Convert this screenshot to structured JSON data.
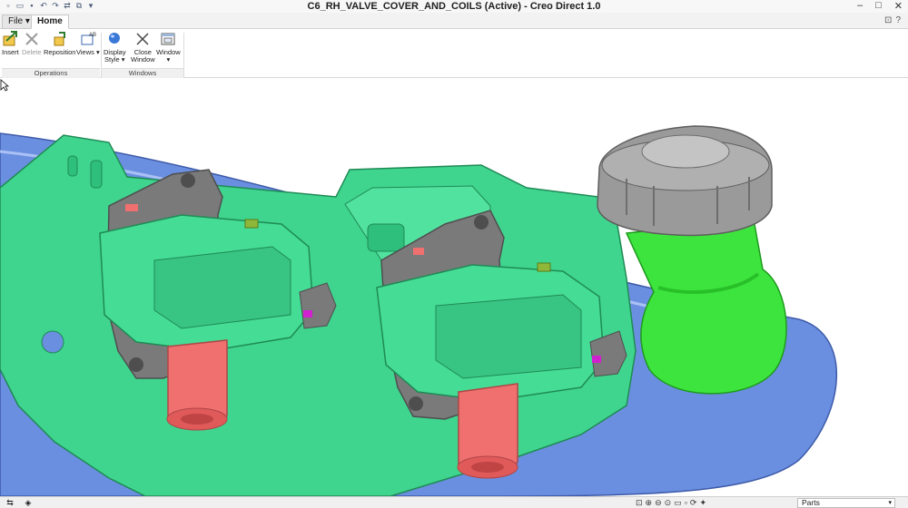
{
  "window": {
    "title": "C6_RH_VALVE_COVER_AND_COILS (Active) - Creo Direct 1.0",
    "controls": [
      "–",
      "□",
      "✕"
    ]
  },
  "quick_access": [
    "new-icon",
    "open-icon",
    "save-icon",
    "undo-icon",
    "redo-icon",
    "regenerate-icon",
    "windows-icon",
    "customize-icon"
  ],
  "tabs": {
    "file": "File",
    "home": "Home"
  },
  "ribbon": {
    "insert": "Insert",
    "delete": "Delete",
    "reposition": "Reposition",
    "views": "Views",
    "display_style_1": "Display",
    "display_style_2": "Style",
    "close_window_1": "Close",
    "close_window_2": "Window",
    "window": "Window",
    "group_operations": "Operations",
    "group_windows": "Windows"
  },
  "status": {
    "filter_value": "Parts"
  },
  "colors": {
    "valve_cover": "#6b8fe0",
    "coil_body": "#3fd58e",
    "bracket": "#7a7a7a",
    "boot": "#f07070",
    "oil_neck": "#3ee43e",
    "oil_cap": "#9a9a9a"
  }
}
